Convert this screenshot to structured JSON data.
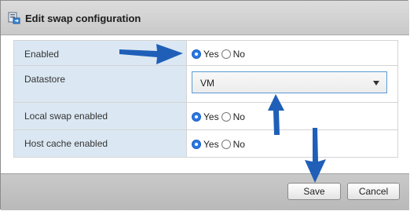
{
  "dialog": {
    "title": "Edit swap configuration",
    "icon": "swap-config-icon"
  },
  "form": {
    "rows": [
      {
        "label": "Enabled",
        "type": "radio",
        "selected": "Yes",
        "options": [
          "Yes",
          "No"
        ]
      },
      {
        "label": "Datastore",
        "type": "select",
        "value": "VM"
      },
      {
        "label": "Local swap enabled",
        "type": "radio",
        "selected": "Yes",
        "options": [
          "Yes",
          "No"
        ]
      },
      {
        "label": "Host cache enabled",
        "type": "radio",
        "selected": "Yes",
        "options": [
          "Yes",
          "No"
        ]
      }
    ]
  },
  "footer": {
    "save_label": "Save",
    "cancel_label": "Cancel"
  },
  "colors": {
    "accent": "#2b78e4",
    "label_bg": "#dbe8f3",
    "annotation_arrow": "#1f5fb8"
  },
  "annotations": {
    "arrow_icon": "blue-arrow-icon"
  }
}
